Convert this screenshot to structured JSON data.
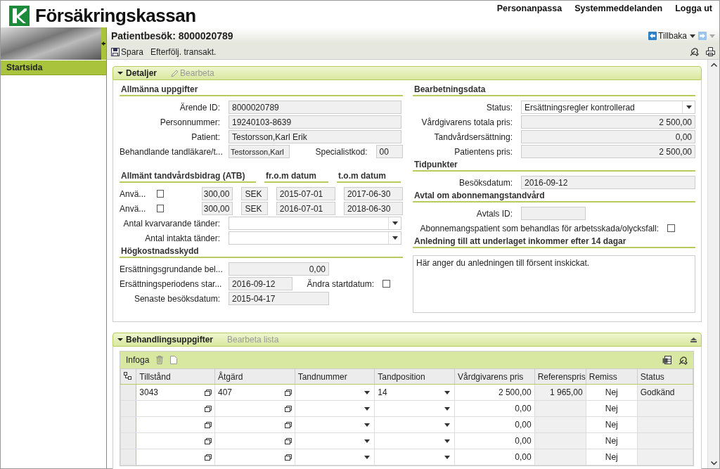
{
  "header": {
    "logo_text": "Försäkringskassan",
    "links": [
      "Personanpassa",
      "Systemmeddelanden",
      "Logga ut"
    ]
  },
  "sidebar": {
    "items": [
      {
        "label": "Startsida",
        "selected": true
      }
    ]
  },
  "page": {
    "title": "Patientbesök: 8000020789",
    "back_button": "Tillbaka"
  },
  "toolbar": {
    "buttons": [
      "Spara",
      "Efterfölj. transakt."
    ]
  },
  "details": {
    "title": "Detaljer",
    "expanded": true,
    "edit_link": "Bearbeta",
    "general": {
      "heading": "Allmänna uppgifter",
      "fields": [
        {
          "label": "Ärende ID:",
          "value": "8000020789"
        },
        {
          "label": "Personnummer:",
          "value": "19240103-8639"
        },
        {
          "label": "Patient:",
          "value": "Testorsson,Karl Erik"
        }
      ],
      "dentist": {
        "label": "Behandlande tandläkare/t...",
        "value": "Testorsson,Karl",
        "code_label": "Specialistkod:",
        "code_value": "00"
      }
    },
    "atb": {
      "headings": [
        "Allmänt tandvårdsbidrag (ATB)",
        "fr.o.m datum",
        "t.o.m datum"
      ],
      "rows": [
        {
          "label": "Anvä...",
          "checked": false,
          "amount": "300,00",
          "currency": "SEK",
          "from": "2015-07-01",
          "to": "2017-06-30"
        },
        {
          "label": "Anvä...",
          "checked": false,
          "amount": "300,00",
          "currency": "SEK",
          "from": "2016-07-01",
          "to": "2018-06-30"
        }
      ],
      "dropdowns": [
        {
          "label": "Antal kvarvarande tänder:"
        },
        {
          "label": "Antal intakta tänder:"
        }
      ]
    },
    "high_cost": {
      "heading": "Högkostnadsskydd",
      "amount_label": "Ersättningsgrundande bel...",
      "amount": "0,00",
      "start_label": "Ersättningsperiodens star...",
      "start": "2016-09-12",
      "change_label": "Ändra startdatum:",
      "change_checked": false,
      "last_label": "Senaste besöksdatum:",
      "last": "2015-04-17"
    },
    "processing": {
      "heading": "Bearbetningsdata",
      "status_label": "Status:",
      "status": "Ersättningsregler kontrollerad",
      "prices": [
        {
          "label": "Vårdgivarens totala pris:",
          "value": "2 500,00"
        },
        {
          "label": "Tandvårdsersättning:",
          "value": "0,00"
        },
        {
          "label": "Patientens pris:",
          "value": "2 500,00"
        }
      ]
    },
    "times": {
      "heading": "Tidpunkter",
      "label": "Besöksdatum:",
      "value": "2016-09-12"
    },
    "subscription": {
      "heading": "Avtal om abonnemangstandvård",
      "id_label": "Avtals ID:",
      "injury_label": "Abonnemangspatient som behandlas för arbetsskada/olycksfall:",
      "injury_checked": false
    },
    "late_reason": {
      "heading": "Anledning till att underlaget inkommer efter 14 dagar",
      "value": "Här anger du anledningen till försent inskickat."
    }
  },
  "treatments": {
    "title": "Behandlingsuppgifter",
    "expanded": true,
    "edit_link": "Bearbeta lista",
    "insert_button": "Infoga",
    "table": {
      "columns": [
        "Tillstånd",
        "Åtgärd",
        "Tandnummer",
        "Tandposition",
        "Vårdgivarens pris",
        "Referenspris",
        "Remiss",
        "Status"
      ],
      "rows": [
        [
          "3043",
          "407",
          "",
          "14",
          "2 500,00",
          "1 965,00",
          "Nej",
          "Godkänd"
        ],
        [
          "",
          "",
          "",
          "",
          "0,00",
          "",
          "Nej",
          ""
        ],
        [
          "",
          "",
          "",
          "",
          "0,00",
          "",
          "Nej",
          ""
        ],
        [
          "",
          "",
          "",
          "",
          "0,00",
          "",
          "Nej",
          ""
        ],
        [
          "",
          "",
          "",
          "",
          "0,00",
          "",
          "Nej",
          ""
        ]
      ]
    }
  }
}
